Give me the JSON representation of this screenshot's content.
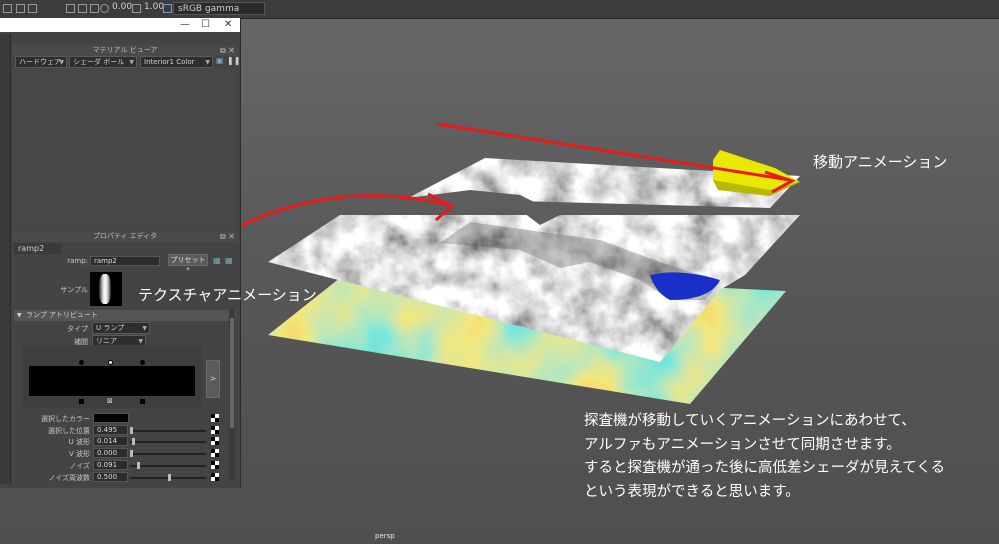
{
  "topbar": {
    "value1": "0.00",
    "value2": "1.00",
    "color_space": "sRGB gamma"
  },
  "material_viewer": {
    "title": "マテリアル ビューア",
    "renderer": "ハードウェア",
    "shader_ball": "シェーダ ボール",
    "lighting": "Interior1 Color"
  },
  "property_editor": {
    "title": "プロパティ エディタ",
    "tab": "ramp2",
    "ramp_label": "ramp:",
    "ramp_value": "ramp2",
    "preset_button": "プリセット*",
    "sample_label": "サンプル",
    "section_title": "ランプ アトリビュート",
    "type_label": "タイプ",
    "type_value": "U ランプ",
    "interp_label": "補間",
    "interp_value": "リニア",
    "ramp_arrow": ">",
    "rows": [
      {
        "label": "選択したカラー",
        "value": ""
      },
      {
        "label": "選択した位置",
        "value": "0.495"
      },
      {
        "label": "U 波形",
        "value": "0.014"
      },
      {
        "label": "V 波形",
        "value": "0.000"
      },
      {
        "label": "ノイズ",
        "value": "0.091"
      },
      {
        "label": "ノイズ周波数",
        "value": "0.500"
      }
    ]
  },
  "annotations": {
    "move_anim": "移動アニメーション",
    "texture_anim": "テクスチャアニメーション",
    "body": [
      "探査機が移動していくアニメーションにあわせて、",
      "アルファもアニメーションさせて同期させます。",
      "すると探査機が通った後に高低差シェーダが見えてくる",
      "という表現ができると思います。"
    ]
  },
  "viewport_label": "persp",
  "colors": {
    "annotation_red": "#e81a1a",
    "probe_yellow": "#e8e800"
  }
}
